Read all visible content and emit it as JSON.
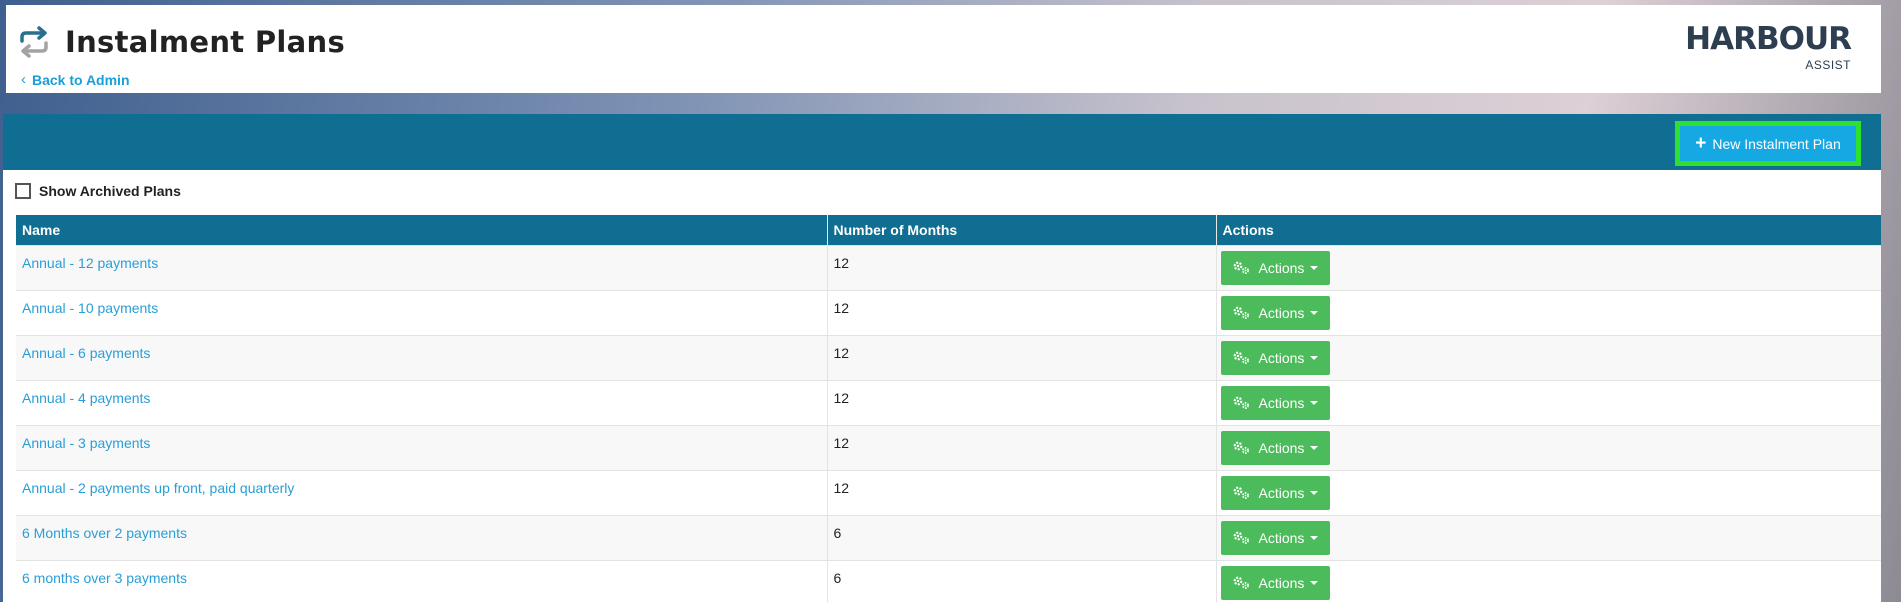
{
  "header": {
    "title": "Instalment Plans",
    "back_link": "Back to Admin",
    "logo": {
      "main": "HARBOUR",
      "sub": "ASSIST"
    }
  },
  "toolbar": {
    "new_button_label": "New Instalment Plan"
  },
  "filters": {
    "show_archived_label": "Show Archived Plans",
    "show_archived_checked": false
  },
  "table": {
    "columns": [
      "Name",
      "Number of Months",
      "Actions"
    ],
    "rows": [
      {
        "name": "Annual - 12 payments",
        "months": "12",
        "action": "Actions"
      },
      {
        "name": "Annual - 10 payments",
        "months": "12",
        "action": "Actions"
      },
      {
        "name": "Annual - 6 payments",
        "months": "12",
        "action": "Actions"
      },
      {
        "name": "Annual - 4 payments",
        "months": "12",
        "action": "Actions"
      },
      {
        "name": "Annual - 3 payments",
        "months": "12",
        "action": "Actions"
      },
      {
        "name": "Annual - 2 payments up front, paid quarterly",
        "months": "12",
        "action": "Actions"
      },
      {
        "name": "6 Months over 2 payments",
        "months": "6",
        "action": "Actions"
      },
      {
        "name": "6 months over 3 payments",
        "months": "6",
        "action": "Actions"
      }
    ]
  },
  "colors": {
    "primary": "#0f6e92",
    "link": "#2a9ed6",
    "action_green": "#4cbb5b",
    "button_blue": "#16a8e3",
    "highlight": "#2fe12f"
  }
}
